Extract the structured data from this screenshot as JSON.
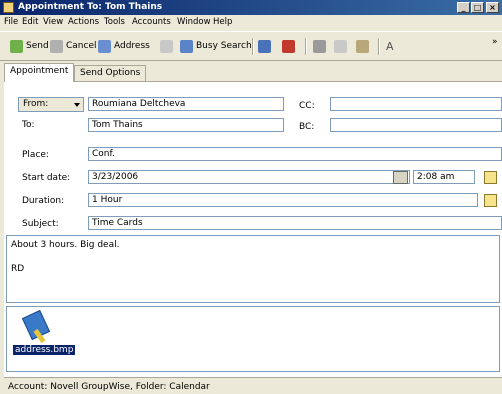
{
  "window": {
    "title": "Appointment To: Tom Thains",
    "minimize": "_",
    "maximize": "□",
    "close": "×"
  },
  "menu": [
    "File",
    "Edit",
    "View",
    "Actions",
    "Tools",
    "Accounts",
    "Window",
    "Help"
  ],
  "toolbar": {
    "send": "Send",
    "cancel": "Cancel",
    "address": "Address",
    "busy_search": "Busy Search",
    "font": "A",
    "overflow": "»"
  },
  "tabs": [
    "Appointment",
    "Send Options"
  ],
  "form": {
    "from_label": "From:",
    "from_value": "Roumiana Deltcheva",
    "to_label": "To:",
    "to_value": "Tom Thains",
    "cc_label": "CC:",
    "cc_value": "",
    "bc_label": "BC:",
    "bc_value": "",
    "place_label": "Place:",
    "place_value": "Conf.",
    "start_date_label": "Start date:",
    "start_date_value": "3/23/2006",
    "start_time_value": "2:08 am",
    "duration_label": "Duration:",
    "duration_value": "1 Hour",
    "subject_label": "Subject:",
    "subject_value": "Time Cards"
  },
  "message": {
    "line1": "About 3 hours. Big deal.",
    "line2": "RD"
  },
  "attachment": {
    "filename": "address.bmp"
  },
  "status": "Account: Novell GroupWise,  Folder: Calendar",
  "colors": {
    "titlebar": "#0a246a",
    "selection": "#0a246a",
    "chrome": "#ece9d8"
  }
}
